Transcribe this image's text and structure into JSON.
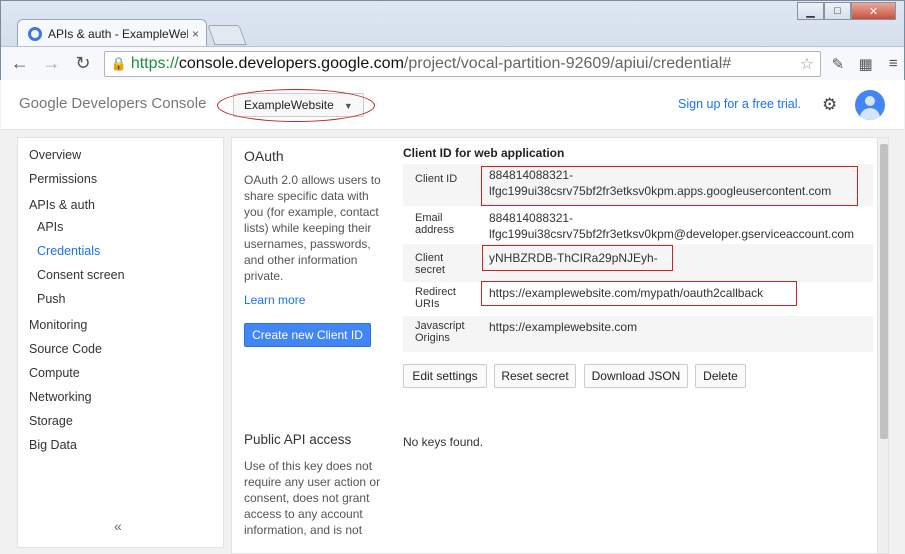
{
  "browser": {
    "tab_title": "APIs & auth - ExampleWeb",
    "tab_close": "×",
    "url_scheme": "https://",
    "url_host": "console.developers.google.com",
    "url_path": "/project/vocal-partition-92609/apiui/credential#",
    "window_buttons": [
      "▁",
      "□",
      "✕"
    ]
  },
  "header": {
    "logo_google": "Google",
    "logo_product": "Developers Console",
    "project": "ExampleWebsite",
    "signup": "Sign up for a free trial."
  },
  "sidebar": {
    "items": [
      "Overview",
      "Permissions",
      "APIs & auth",
      "APIs",
      "Credentials",
      "Consent screen",
      "Push",
      "Monitoring",
      "Source Code",
      "Compute",
      "Networking",
      "Storage",
      "Big Data"
    ],
    "collapse": "«"
  },
  "oauth": {
    "title": "OAuth",
    "description": "OAuth 2.0 allows users to share specific data with you (for example, contact lists) while keeping their usernames, passwords, and other information private.",
    "learn_more": "Learn more",
    "create_button": "Create new Client ID"
  },
  "client": {
    "title": "Client ID for web application",
    "rows": [
      {
        "label": "Client ID",
        "value_1": "884814088321-",
        "value_2": "lfgc199ui38csrv75bf2fr3etksv0kpm.apps.googleusercontent.com"
      },
      {
        "label": "Email address",
        "value_1": "884814088321-",
        "value_2": "lfgc199ui38csrv75bf2fr3etksv0kpm@developer.gserviceaccount.com"
      },
      {
        "label": "Client secret",
        "value_1": "yNHBZRDB-ThCIRa29pNJEyh-"
      },
      {
        "label": "Redirect URIs",
        "value_1": "https://examplewebsite.com/mypath/oauth2callback"
      },
      {
        "label": "Javascript Origins",
        "value_1": "https://examplewebsite.com"
      }
    ],
    "buttons": [
      "Edit settings",
      "Reset secret",
      "Download JSON",
      "Delete"
    ]
  },
  "public_api": {
    "title": "Public API access",
    "description": "Use of this key does not require any user action or consent, does not grant access to any account information, and is not",
    "no_keys": "No keys found."
  },
  "colors": {
    "accent": "#4285f4",
    "link": "#1a73e8",
    "highlight": "#cc2222"
  }
}
